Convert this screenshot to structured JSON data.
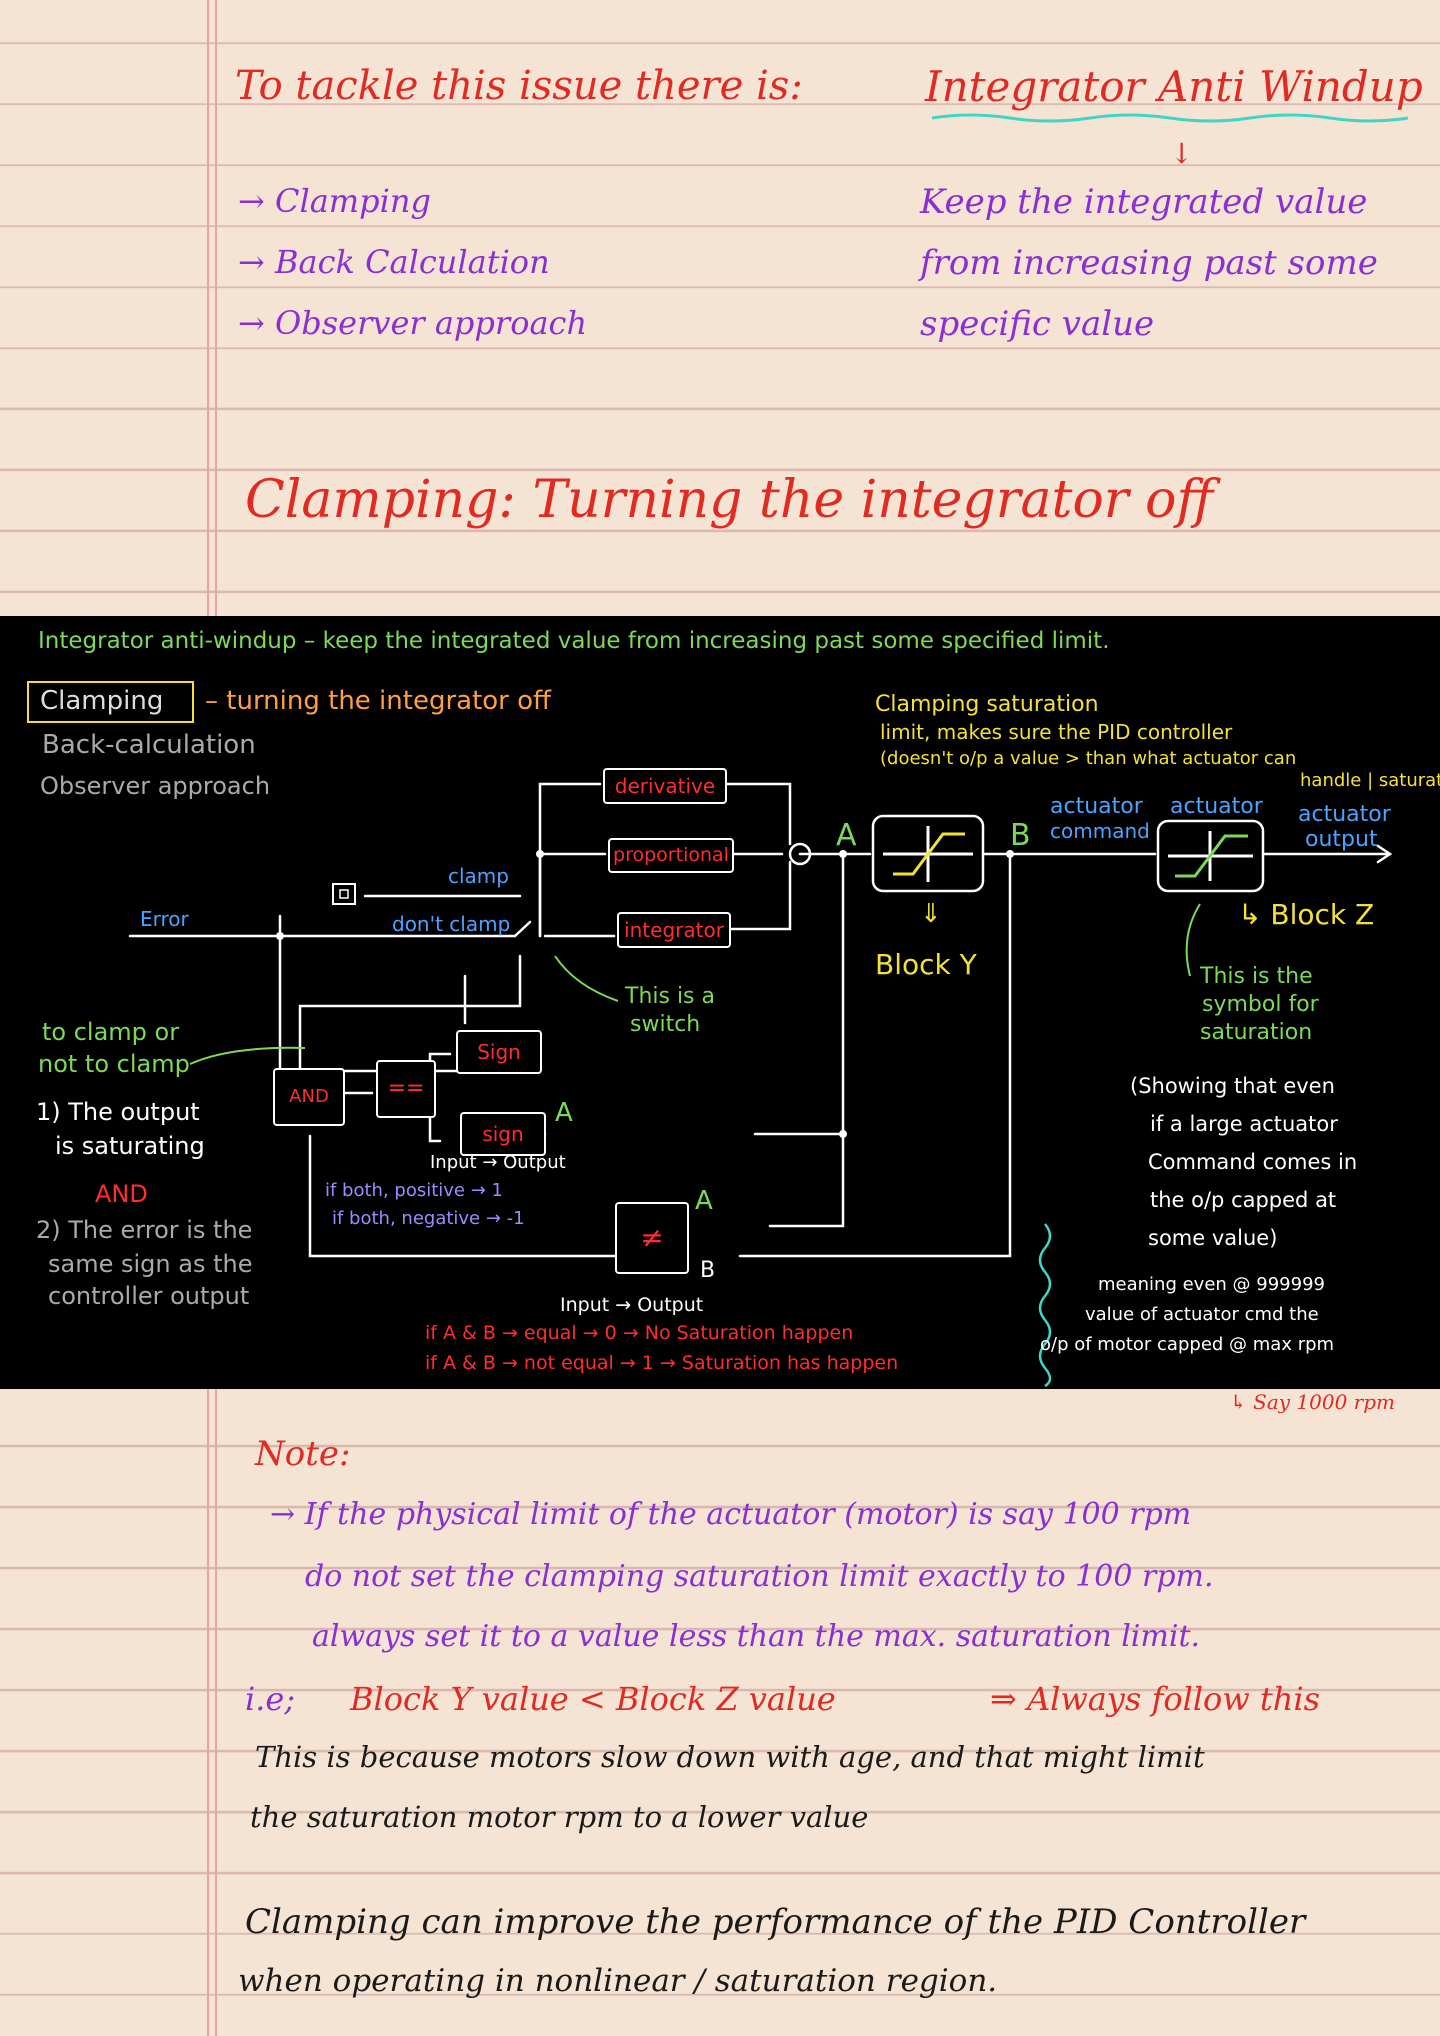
{
  "top": {
    "heading_left": "To tackle this issue there is:",
    "heading_right": "Integrator Anti Windup",
    "methods": [
      "→ Clamping",
      "→ Back Calculation",
      "→ Observer approach"
    ],
    "definition": [
      "Keep the integrated value",
      "from increasing past some",
      "specific value"
    ],
    "clamping_title": "Clamping: Turning the integrator off"
  },
  "board": {
    "header": "Integrator anti-windup – keep the integrated value from increasing past some specified limit.",
    "clamping": "Clamping",
    "clamping_desc": "– turning the integrator off",
    "back_calc": "Back-calculation",
    "observer": "Observer approach",
    "error": "Error",
    "clamp": "clamp",
    "dont_clamp": "don't clamp",
    "derivative": "derivative",
    "proportional": "proportional",
    "integrator": "integrator",
    "switch_note": [
      "This is a",
      "switch"
    ],
    "sat_limit_title": "Clamping saturation",
    "sat_limit_line2": "limit, makes sure the PID controller",
    "sat_limit_line3": "(doesn't o/p a value > than what actuator can",
    "sat_limit_line4": "handle | saturate",
    "label_a": "A",
    "label_b": "B",
    "actuator_command": [
      "actuator",
      "command"
    ],
    "actuator": "actuator",
    "actuator_output": [
      "actuator",
      "output"
    ],
    "block_y": "Block Y",
    "block_z": "↳ Block Z",
    "sat_symbol_note": [
      "This is the",
      "symbol for",
      "saturation"
    ],
    "sat_explain": [
      "(Showing that even",
      "if a large actuator",
      "Command comes in",
      "the o/p capped at",
      "some value)"
    ],
    "to_clamp": [
      "to clamp or",
      "not to clamp"
    ],
    "cond1": [
      "1) The output",
      "is saturating"
    ],
    "and_text": "AND",
    "cond2": [
      "2) The error is the",
      "same sign as the",
      "controller output"
    ],
    "and_block": "AND",
    "eq_block": "==",
    "sign1": "Sign",
    "sign2": "sign",
    "neq_block": "≠",
    "sign_table": [
      "Input → Output",
      "if both, positive → 1",
      "if both, negative → -1"
    ],
    "neq_table": [
      "Input → Output",
      "if A & B → equal → 0 → No Saturation happen",
      "if A & B → not equal → 1 → Saturation has happen"
    ],
    "meaning": [
      "meaning even @ 999999",
      "value of actuator cmd the",
      "o/p of motor capped @ max rpm"
    ],
    "say_rpm": "↳ Say 1000 rpm"
  },
  "note": {
    "title": "Note:",
    "line1": "→ If the physical limit of the actuator (motor) is say 100 rpm",
    "line2": "do not set the clamping saturation limit exactly to 100 rpm.",
    "line3": "always set it to a value less than the max. saturation limit.",
    "line4_prefix": "i.e;",
    "line4": "Block Y value < Block Z value",
    "line4_suffix": "⇒ Always follow this",
    "line5": "This is because motors slow down with age, and that might limit",
    "line6": "the saturation motor rpm to a lower value",
    "conclusion1": "Clamping can improve the performance of the PID Controller",
    "conclusion2": "when operating in nonlinear / saturation region."
  },
  "colors": {
    "paper": "#f5e3d3",
    "red_ink": "#e02a22",
    "purple_ink": "#8a2fd6",
    "teal_underline": "#3fd6c8",
    "board_yellow": "#f3e13a",
    "board_green": "#7ed957",
    "board_blue": "#4aa3ff",
    "board_purple": "#9b8cff",
    "board_orange": "#ffa040"
  }
}
